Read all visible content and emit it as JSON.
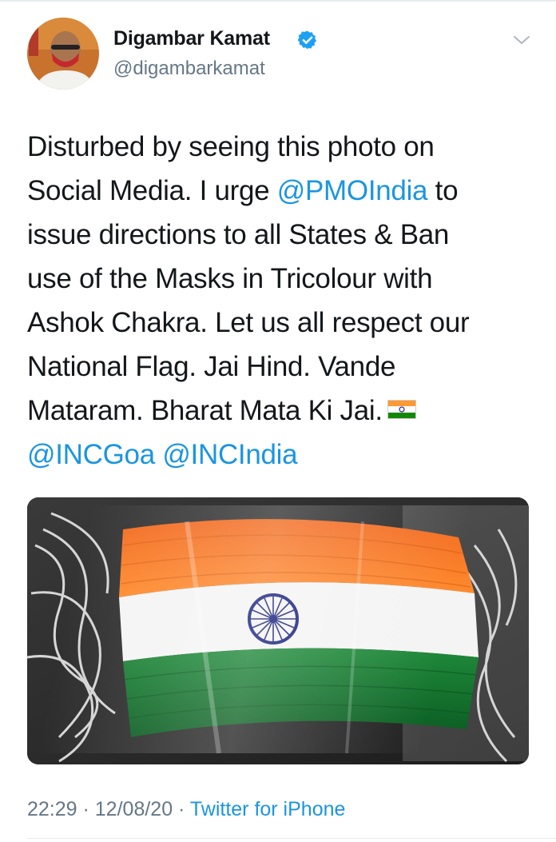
{
  "author": {
    "display_name": "Digambar Kamat",
    "handle": "@digambarkamat",
    "verified": true,
    "avatar_icon": "profile-photo",
    "menu_icon": "chevron-down-icon"
  },
  "tweet": {
    "line1": "Disturbed by seeing this photo on",
    "line2_a": "Social Media. I urge ",
    "mention_pmo": "@PMOIndia",
    "line2_b": " to",
    "line3": "issue directions to all States & Ban",
    "line4": "use of the Masks in Tricolour with",
    "line5": "Ashok Chakra. Let us all respect our",
    "line6": "National Flag. Jai Hind. Vande",
    "line7": "Mataram. Bharat Mata Ki Jai.",
    "emoji": "flag-india",
    "mention_incgoa": "@INCGoa",
    "mention_incindia": "@INCIndia"
  },
  "media": {
    "description_icon": "tricolour-mask-photo"
  },
  "meta": {
    "time": "22:29",
    "separator": " · ",
    "date": "12/08/20",
    "source": "Twitter for iPhone"
  },
  "colors": {
    "link": "#1b95e0",
    "secondary_text": "#657786",
    "primary_text": "#14171a",
    "saffron": "#ff7f1f",
    "green": "#0d7a2b",
    "chakra": "#1a237e"
  }
}
